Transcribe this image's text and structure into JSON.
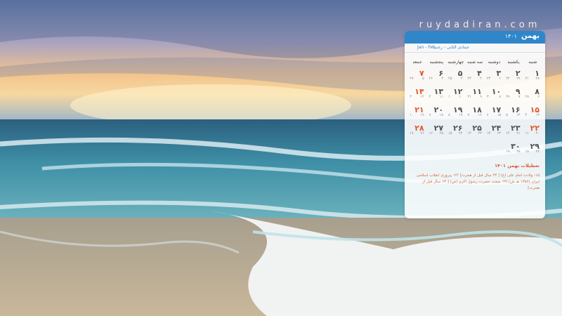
{
  "watermark": "ruydadiran.com",
  "calendar": {
    "month_title": "بهمن",
    "year": "۱۴۰۱",
    "hijri_months": "جمادی الثانی - رجب",
    "gregorian_months": "Jan - Feb",
    "weekdays": [
      "شنبه",
      "یکشنبه",
      "دوشنبه",
      "سه شنبه",
      "چهارشنبه",
      "پنجشنبه",
      "جمعه"
    ],
    "days": [
      {
        "d": "۱",
        "g": "۲۱",
        "h": "۲۸"
      },
      {
        "d": "۲",
        "g": "۲۲",
        "h": "۲۹"
      },
      {
        "d": "۳",
        "g": "۲۳",
        "h": "۱"
      },
      {
        "d": "۴",
        "g": "۲۴",
        "h": "۲"
      },
      {
        "d": "۵",
        "g": "۲۵",
        "h": "۳"
      },
      {
        "d": "۶",
        "g": "۲۶",
        "h": "۴"
      },
      {
        "d": "۷",
        "g": "۲۷",
        "h": "۵"
      },
      {
        "d": "۸",
        "g": "۲۸",
        "h": "۶"
      },
      {
        "d": "۹",
        "g": "۲۹",
        "h": "۷"
      },
      {
        "d": "۱۰",
        "g": "۳۰",
        "h": "۸"
      },
      {
        "d": "۱۱",
        "g": "۳۱",
        "h": "۹"
      },
      {
        "d": "۱۲",
        "g": "۱",
        "h": "۱۰"
      },
      {
        "d": "۱۳",
        "g": "۲",
        "h": "۱۱"
      },
      {
        "d": "۱۴",
        "g": "۳",
        "h": "۱۲"
      },
      {
        "d": "۱۵",
        "g": "۴",
        "h": "۱۳",
        "holiday": true
      },
      {
        "d": "۱۶",
        "g": "۵",
        "h": "۱۴"
      },
      {
        "d": "۱۷",
        "g": "۶",
        "h": "۱۵"
      },
      {
        "d": "۱۸",
        "g": "۷",
        "h": "۱۶"
      },
      {
        "d": "۱۹",
        "g": "۸",
        "h": "۱۷"
      },
      {
        "d": "۲۰",
        "g": "۹",
        "h": "۱۸"
      },
      {
        "d": "۲۱",
        "g": "۱۰",
        "h": "۱۹"
      },
      {
        "d": "۲۲",
        "g": "۱۱",
        "h": "۲۰",
        "holiday": true
      },
      {
        "d": "۲۳",
        "g": "۱۲",
        "h": "۲۱"
      },
      {
        "d": "۲۴",
        "g": "۱۳",
        "h": "۲۲"
      },
      {
        "d": "۲۵",
        "g": "۱۴",
        "h": "۲۳"
      },
      {
        "d": "۲۶",
        "g": "۱۵",
        "h": "۲۴"
      },
      {
        "d": "۲۷",
        "g": "۱۶",
        "h": "۲۵"
      },
      {
        "d": "۲۸",
        "g": "۱۷",
        "h": "۲۶"
      },
      {
        "d": "۲۹",
        "g": "۱۸",
        "h": "۲۷"
      },
      {
        "d": "۳۰",
        "g": "۱۹",
        "h": "۲۸"
      }
    ],
    "holidays_title": "تعطیلات بهمن ۱۴۰۱",
    "holidays_text": "۱۵- ولادت امام علی (ع) [ ۲۳ سال قبل از هجرت] ۲۲- پیروزی انقلاب اسلامی ایران (۱۳۵۷ هـ ش) ۲۹- مبعث حضرت رسول اکرم (ص) [ ۱۳ سال قبل از هجرت]"
  },
  "colors": {
    "header_blue": "#2f86c9",
    "holiday_red": "#e4572e"
  }
}
